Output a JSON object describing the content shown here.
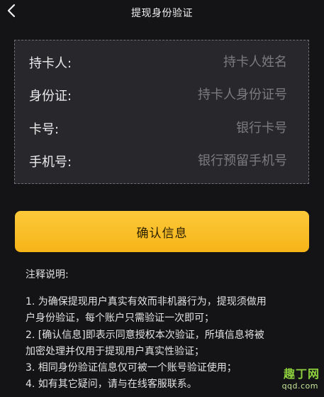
{
  "header": {
    "title": "提现身份验证",
    "back_icon": "chevron-left-icon"
  },
  "form": {
    "rows": [
      {
        "label": "持卡人:",
        "placeholder": "持卡人姓名"
      },
      {
        "label": "身份证:",
        "placeholder": "持卡人身份证号"
      },
      {
        "label": "卡号:",
        "placeholder": "银行卡号"
      },
      {
        "label": "手机号:",
        "placeholder": "银行预留手机号"
      }
    ]
  },
  "confirm_button": {
    "label": "确认信息"
  },
  "notes": {
    "title": "注释说明:",
    "items": [
      "1. 为确保提现用户真实有效而非机器行为，提现须做用",
      "户身份验证，每个账户只需验证一次即可；",
      "2. [确认信息]即表示同意授权本次验证，所填信息将被",
      "加密处理并仅用于提现用户真实性验证；",
      "3. 相同身份验证信息仅可被一个账号验证使用；",
      "4. 如有其它疑问，请与在线客服联系。"
    ]
  },
  "watermark": {
    "text": "趣丁网",
    "sub": "qqd.com"
  },
  "colors": {
    "background": "#141416",
    "panel": "#28282c",
    "accent": "#f6b418"
  }
}
